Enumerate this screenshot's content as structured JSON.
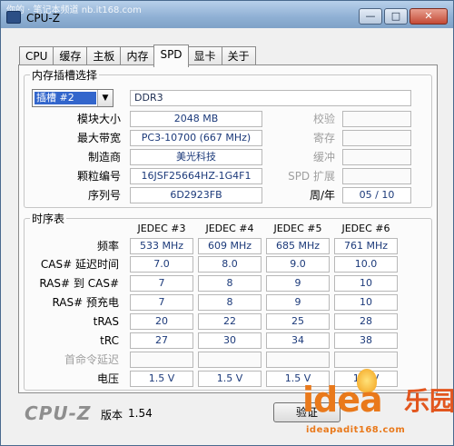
{
  "titlebar": {
    "watermark": "你的 · 笔记本频道  nb.it168.com",
    "title": "CPU-Z",
    "min": "—",
    "max": "□",
    "close": "✕"
  },
  "tabs": [
    "CPU",
    "缓存",
    "主板",
    "内存",
    "SPD",
    "显卡",
    "关于"
  ],
  "active_tab": "SPD",
  "slot": {
    "legend": "内存插槽选择",
    "selected": "插槽 #2",
    "type": "DDR3",
    "rows": [
      {
        "label": "模块大小",
        "value": "2048 MB"
      },
      {
        "label": "最大带宽",
        "value": "PC3-10700 (667 MHz)"
      },
      {
        "label": "制造商",
        "value": "美光科技"
      },
      {
        "label": "颗粒编号",
        "value": "16JSF25664HZ-1G4F1"
      },
      {
        "label": "序列号",
        "value": "6D2923FB"
      }
    ],
    "right_labels": [
      "校验",
      "寄存",
      "缓冲",
      "SPD 扩展",
      "周/年"
    ],
    "week_year": "05 / 10"
  },
  "timings": {
    "legend": "时序表",
    "columns": [
      "JEDEC #3",
      "JEDEC #4",
      "JEDEC #5",
      "JEDEC #6"
    ],
    "rows": [
      {
        "label": "频率",
        "values": [
          "533 MHz",
          "609 MHz",
          "685 MHz",
          "761 MHz"
        ]
      },
      {
        "label": "CAS# 延迟时间",
        "values": [
          "7.0",
          "8.0",
          "9.0",
          "10.0"
        ]
      },
      {
        "label": "RAS# 到 CAS#",
        "values": [
          "7",
          "8",
          "9",
          "10"
        ]
      },
      {
        "label": "RAS# 预充电",
        "values": [
          "7",
          "8",
          "9",
          "10"
        ]
      },
      {
        "label": "tRAS",
        "values": [
          "20",
          "22",
          "25",
          "28"
        ]
      },
      {
        "label": "tRC",
        "values": [
          "27",
          "30",
          "34",
          "38"
        ]
      },
      {
        "label": "首命令延迟",
        "values": [
          "",
          "",
          "",
          ""
        ]
      },
      {
        "label": "电压",
        "values": [
          "1.5 V",
          "1.5 V",
          "1.5 V",
          "1.5 V"
        ]
      }
    ]
  },
  "footer": {
    "brand": "CPU-Z",
    "version_label": "版本",
    "version": "1.54",
    "validate": "验证"
  },
  "watermark_logo": {
    "word": "idea",
    "cn": "乐园",
    "url": "ideapadit168.com"
  }
}
